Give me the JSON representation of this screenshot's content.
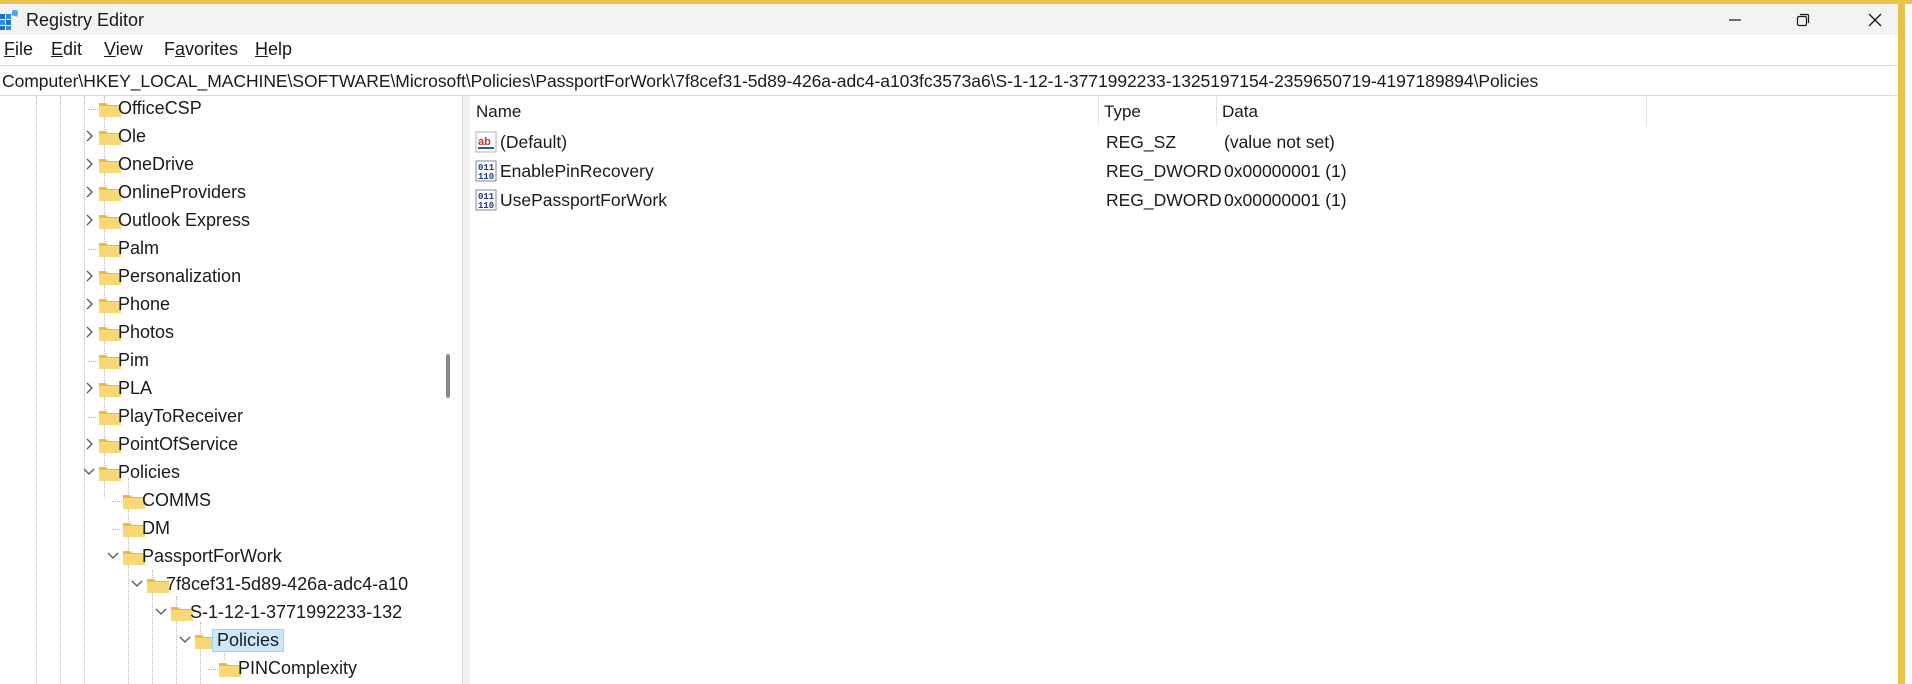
{
  "window": {
    "title": "Registry Editor"
  },
  "menu": {
    "file": {
      "acc": "F",
      "rest": "ile"
    },
    "edit": {
      "acc": "E",
      "rest": "dit"
    },
    "view": {
      "acc": "V",
      "rest": "iew"
    },
    "favorites": {
      "pre": "F",
      "acc": "a",
      "rest": "vorites"
    },
    "help": {
      "acc": "H",
      "rest": "elp"
    }
  },
  "address": {
    "path": "Computer\\HKEY_LOCAL_MACHINE\\SOFTWARE\\Microsoft\\Policies\\PassportForWork\\7f8cef31-5d89-426a-adc4-a103fc3573a6\\S-1-12-1-3771992233-1325197154-2359650719-4197189894\\Policies"
  },
  "tree": {
    "items": [
      {
        "label": "OfficeCSP"
      },
      {
        "label": "Ole"
      },
      {
        "label": "OneDrive"
      },
      {
        "label": "OnlineProviders"
      },
      {
        "label": "Outlook Express"
      },
      {
        "label": "Palm"
      },
      {
        "label": "Personalization"
      },
      {
        "label": "Phone"
      },
      {
        "label": "Photos"
      },
      {
        "label": "Pim"
      },
      {
        "label": "PLA"
      },
      {
        "label": "PlayToReceiver"
      },
      {
        "label": "PointOfService"
      },
      {
        "label": "Policies"
      },
      {
        "label": "COMMS"
      },
      {
        "label": "DM"
      },
      {
        "label": "PassportForWork"
      },
      {
        "label": "7f8cef31-5d89-426a-adc4-a10"
      },
      {
        "label": "S-1-12-1-3771992233-132"
      },
      {
        "label": "Policies"
      },
      {
        "label": "PINComplexity"
      }
    ]
  },
  "list": {
    "columns": {
      "name": "Name",
      "type": "Type",
      "data": "Data"
    },
    "rows": [
      {
        "name": "(Default)",
        "type": "REG_SZ",
        "data": "(value not set)",
        "icon": "string-value-icon"
      },
      {
        "name": "EnablePinRecovery",
        "type": "REG_DWORD",
        "data": "0x00000001 (1)",
        "icon": "binary-value-icon"
      },
      {
        "name": "UsePassportForWork",
        "type": "REG_DWORD",
        "data": "0x00000001 (1)",
        "icon": "binary-value-icon"
      }
    ]
  },
  "colors": {
    "accent_border": "#e8c24a",
    "selection": "#cce8ff",
    "folder": "#f8d775"
  }
}
